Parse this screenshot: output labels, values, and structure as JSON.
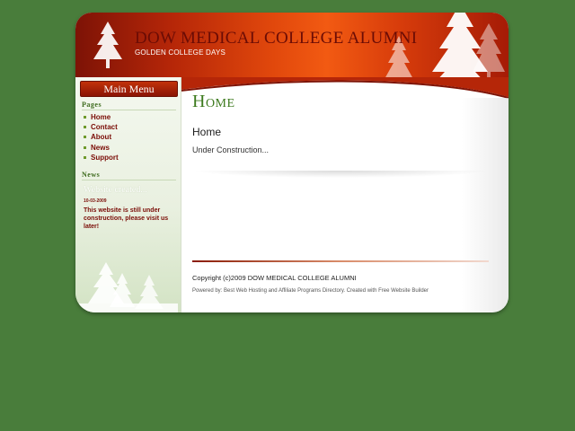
{
  "header": {
    "title": "DOW MEDICAL COLLEGE ALUMNI",
    "subtitle": "GOLDEN COLLEGE DAYS"
  },
  "sidebar": {
    "menu_title": "Main Menu",
    "pages_heading": "Pages",
    "items": [
      {
        "label": "Home"
      },
      {
        "label": "Contact"
      },
      {
        "label": "About"
      },
      {
        "label": "News"
      },
      {
        "label": "Support"
      }
    ],
    "news_heading": "News",
    "news_title": "Website created...",
    "news_date": "10-03-2009",
    "news_text": "This website is still under construction, please visit us later!"
  },
  "main": {
    "heading": "Home",
    "title": "Home",
    "text": "Under Construction..."
  },
  "footer": {
    "copyright": "Copyright (c)2009 DOW MEDICAL COLLEGE ALUMNI",
    "powered": "Powered by: Best Web Hosting and Affiliate Programs Directory. Created with Free Website Builder"
  },
  "colors": {
    "background": "#497d3b",
    "header_red": "#b52608",
    "link_red": "#7a0c06",
    "heading_green": "#3d7a1e"
  },
  "icons": [
    "pine-tree-icon",
    "bullet-icon"
  ]
}
